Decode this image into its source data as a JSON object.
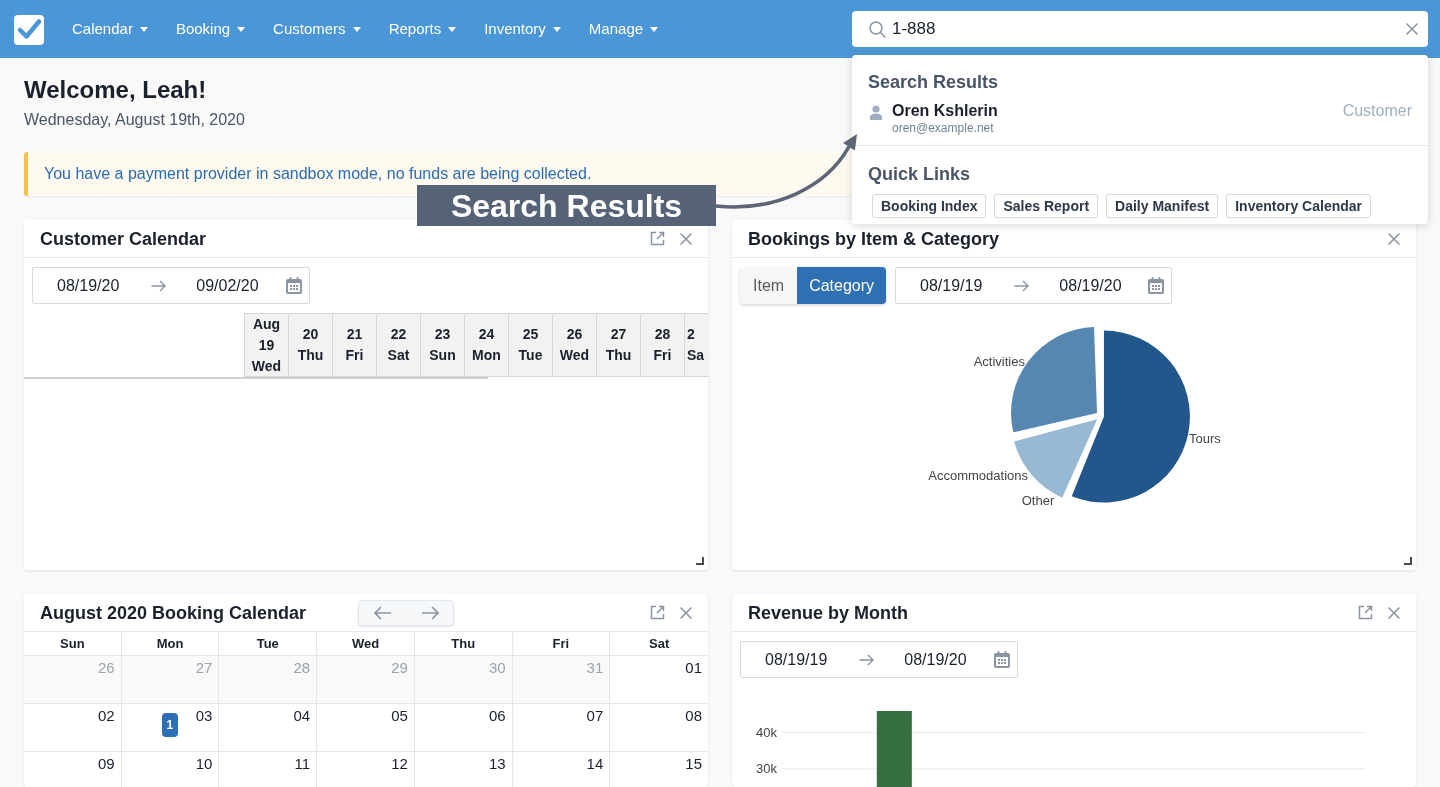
{
  "nav": {
    "items": [
      {
        "label": "Calendar"
      },
      {
        "label": "Booking"
      },
      {
        "label": "Customers"
      },
      {
        "label": "Reports"
      },
      {
        "label": "Inventory"
      },
      {
        "label": "Manage"
      }
    ]
  },
  "search": {
    "value": "1-888",
    "dropdown": {
      "results_heading": "Search Results",
      "results": [
        {
          "name": "Oren Kshlerin",
          "email": "oren@example.net",
          "type": "Customer"
        }
      ],
      "quick_links_heading": "Quick Links",
      "quick_links": [
        {
          "label": "Booking Index"
        },
        {
          "label": "Sales Report"
        },
        {
          "label": "Daily Manifest"
        },
        {
          "label": "Inventory Calendar"
        }
      ]
    }
  },
  "annotation": {
    "text": "Search Results"
  },
  "welcome": {
    "title": "Welcome, Leah!",
    "date": "Wednesday, August 19th, 2020"
  },
  "alert": {
    "text": "You have a payment provider in sandbox mode, no funds are being collected."
  },
  "widgets": [
    {
      "kind": "timeline",
      "title": "Customer Calendar",
      "expandable": true,
      "date_range": {
        "start": "08/19/20",
        "end": "09/02/20"
      },
      "days": [
        {
          "month": "Aug",
          "day": "19",
          "weekday": "Wed"
        },
        {
          "day": "20",
          "weekday": "Thu"
        },
        {
          "day": "21",
          "weekday": "Fri"
        },
        {
          "day": "22",
          "weekday": "Sat"
        },
        {
          "day": "23",
          "weekday": "Sun"
        },
        {
          "day": "24",
          "weekday": "Mon"
        },
        {
          "day": "25",
          "weekday": "Tue"
        },
        {
          "day": "26",
          "weekday": "Wed"
        },
        {
          "day": "27",
          "weekday": "Thu"
        },
        {
          "day": "28",
          "weekday": "Fri"
        },
        {
          "day": "2",
          "weekday": "Sa"
        }
      ]
    },
    {
      "kind": "pie",
      "title": "Bookings by Item & Category",
      "expandable": false,
      "toggle": [
        {
          "label": "Item",
          "selected": false
        },
        {
          "label": "Category",
          "selected": true
        }
      ],
      "date_range": {
        "start": "08/19/19",
        "end": "08/19/20"
      },
      "slices": [
        {
          "label": "Activities",
          "color": "#5587b0"
        },
        {
          "label": "Tours",
          "color": "#22578b"
        },
        {
          "label": "Accommodations",
          "color": "#98b9d4"
        },
        {
          "label": "Other"
        }
      ]
    },
    {
      "kind": "month_calendar",
      "title": "August 2020 Booking Calendar",
      "expandable": true,
      "weekdays": [
        "Sun",
        "Mon",
        "Tue",
        "Wed",
        "Thu",
        "Fri",
        "Sat"
      ],
      "weeks": [
        [
          {
            "day": "26",
            "outside": true
          },
          {
            "day": "27",
            "outside": true
          },
          {
            "day": "28",
            "outside": true
          },
          {
            "day": "29",
            "outside": true
          },
          {
            "day": "30",
            "outside": true
          },
          {
            "day": "31",
            "outside": true
          },
          {
            "day": "01",
            "outside": false
          }
        ],
        [
          {
            "day": "02",
            "outside": false
          },
          {
            "day": "03",
            "outside": false,
            "badge": "1"
          },
          {
            "day": "04",
            "outside": false
          },
          {
            "day": "05",
            "outside": false
          },
          {
            "day": "06",
            "outside": false
          },
          {
            "day": "07",
            "outside": false
          },
          {
            "day": "08",
            "outside": false
          }
        ],
        [
          {
            "day": "09",
            "outside": false
          },
          {
            "day": "10",
            "outside": false
          },
          {
            "day": "11",
            "outside": false
          },
          {
            "day": "12",
            "outside": false
          },
          {
            "day": "13",
            "outside": false
          },
          {
            "day": "14",
            "outside": false
          },
          {
            "day": "15",
            "outside": false
          }
        ]
      ]
    },
    {
      "kind": "bar_chart",
      "title": "Revenue by Month",
      "expandable": true,
      "date_range": {
        "start": "08/19/19",
        "end": "08/19/20"
      },
      "chart_data": {
        "type": "bar",
        "ylim": [
          25000,
          46000
        ],
        "yticks": [
          {
            "value": 30000,
            "label": "30k"
          },
          {
            "value": 40000,
            "label": "40k"
          }
        ],
        "series": [
          {
            "color": "#356f40",
            "values": [
              null,
              null,
              46000,
              null,
              null,
              null,
              null,
              null,
              null,
              null,
              null,
              null,
              null
            ]
          }
        ]
      }
    }
  ]
}
